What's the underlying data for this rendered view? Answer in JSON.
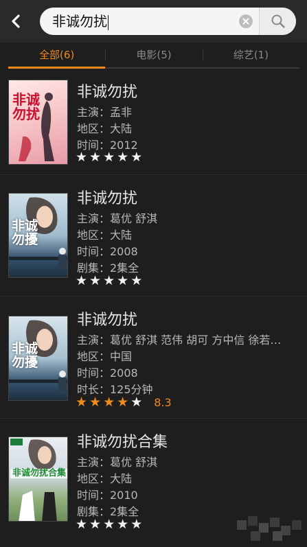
{
  "search": {
    "query": "非诚勿扰"
  },
  "tabs": [
    {
      "label": "全部(6)",
      "active": true
    },
    {
      "label": "电影(5)",
      "active": false
    },
    {
      "label": "综艺(1)",
      "active": false
    }
  ],
  "colors": {
    "accent": "#f08a1d",
    "background": "#1e1e1e"
  },
  "results": [
    {
      "title": "非诚勿扰",
      "poster_text": "非诚勿扰",
      "lines": [
        "主演：孟非",
        "地区：大陆",
        "时间：2012"
      ],
      "stars": 5,
      "stars_filled": 0,
      "rating": ""
    },
    {
      "title": "非诚勿扰",
      "poster_text": "非诚勿擾",
      "lines": [
        "主演：葛优 舒淇",
        "地区：大陆",
        "时间：2008",
        "剧集：2集全"
      ],
      "stars": 5,
      "stars_filled": 0,
      "rating": ""
    },
    {
      "title": "非诚勿扰",
      "poster_text": "非诚勿擾",
      "lines": [
        "主演：葛优 舒淇 范伟 胡可 方中信 徐若…",
        "地区：中国",
        "时间：2008",
        "时长：125分钟"
      ],
      "stars": 5,
      "stars_filled": 4,
      "rating": "8.3"
    },
    {
      "title": "非诚勿扰合集",
      "poster_text": "非诚勿扰合集",
      "lines": [
        "主演：葛优 舒淇",
        "地区：大陆",
        "时间：2010",
        "剧集：2集全"
      ],
      "stars": 5,
      "stars_filled": 0,
      "rating": ""
    }
  ]
}
